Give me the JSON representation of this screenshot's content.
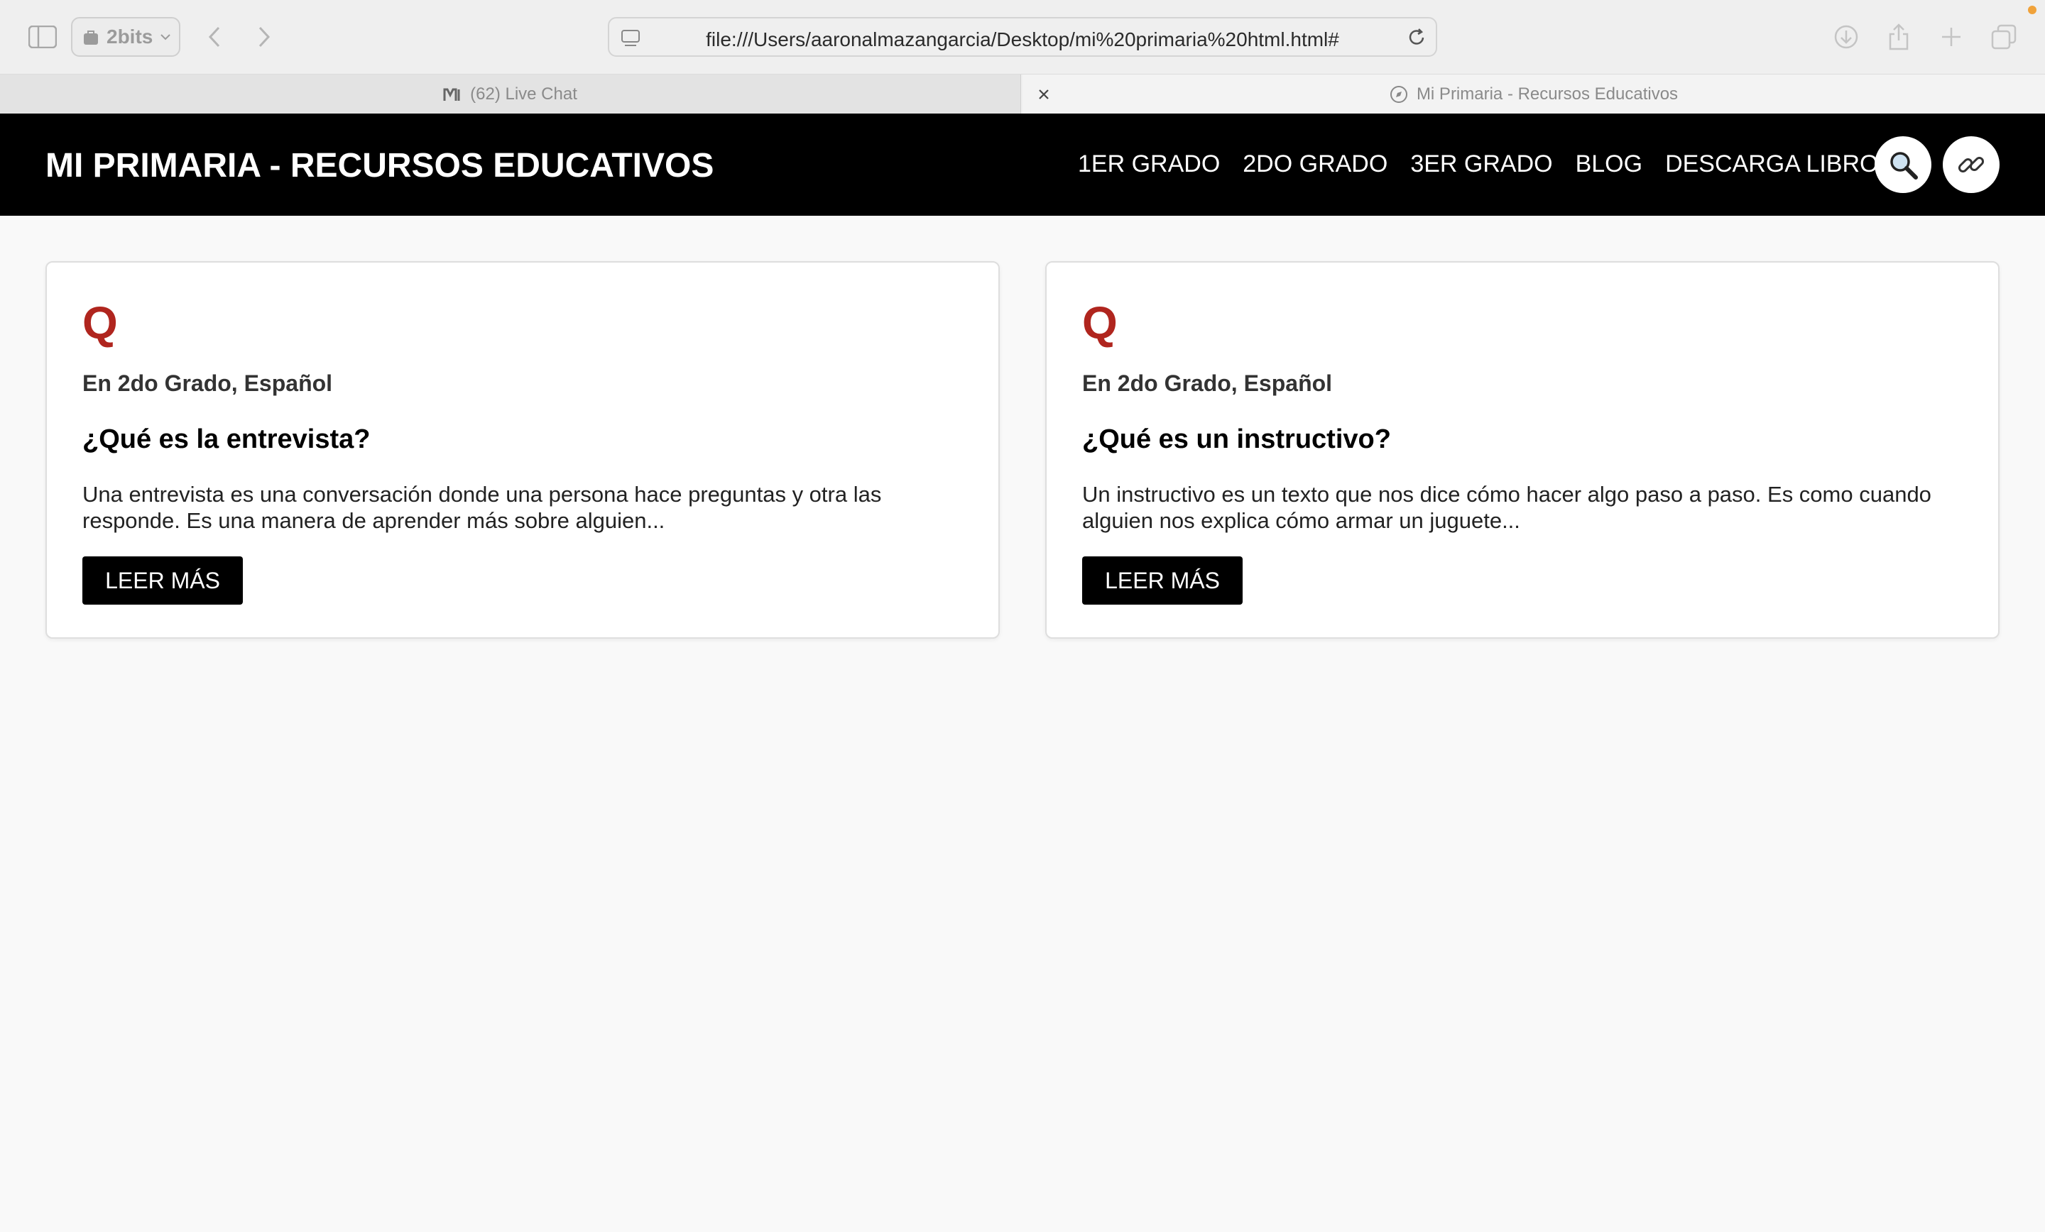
{
  "browser": {
    "profile_label": "2bits",
    "url": "file:///Users/aaronalmazangarcia/Desktop/mi%20primaria%20html.html#"
  },
  "tabs": [
    {
      "label": "(62) Live Chat",
      "icon": "m-logo-icon"
    },
    {
      "label": "Mi Primaria - Recursos Educativos",
      "icon": "compass-icon"
    }
  ],
  "site": {
    "title": "MI PRIMARIA - RECURSOS EDUCATIVOS",
    "nav": [
      "1ER GRADO",
      "2DO GRADO",
      "3ER GRADO",
      "BLOG",
      "DESCARGA LIBROS"
    ]
  },
  "cards": [
    {
      "letter": "Q",
      "meta": "En 2do Grado, Español",
      "title": "¿Qué es la entrevista?",
      "text": "Una entrevista es una conversación donde una persona hace preguntas y otra las responde. Es una manera de aprender más sobre alguien...",
      "button": "LEER MÁS"
    },
    {
      "letter": "Q",
      "meta": "En 2do Grado, Español",
      "title": "¿Qué es un instructivo?",
      "text": "Un instructivo es un texto que nos dice cómo hacer algo paso a paso. Es como cuando alguien nos explica cómo armar un juguete...",
      "button": "LEER MÁS"
    }
  ],
  "colors": {
    "accent": "#b0251e",
    "header_bg": "#000000",
    "page_bg": "#f9f9f9"
  }
}
